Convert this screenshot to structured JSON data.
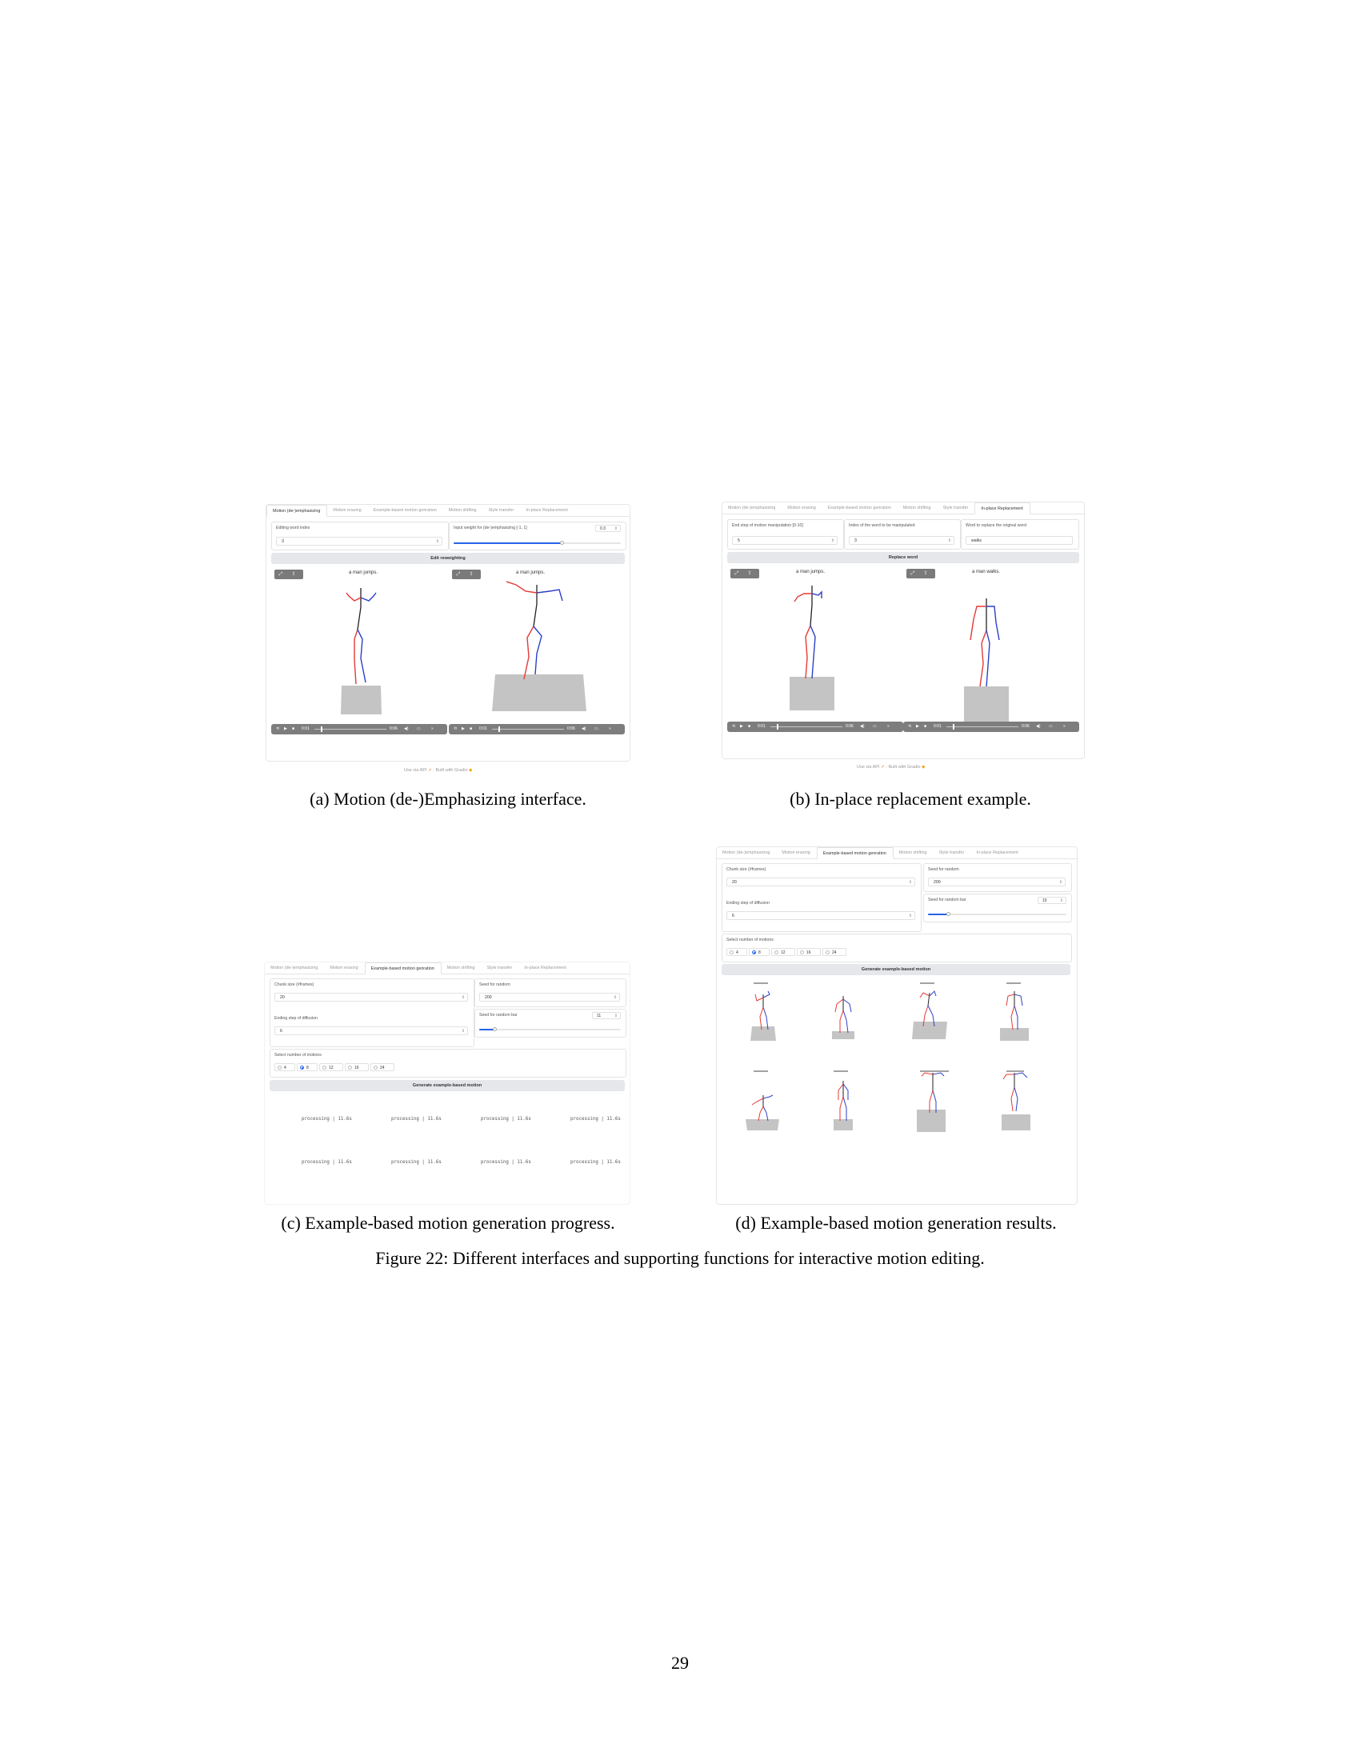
{
  "tabs": [
    "Motion (de-)emphasizing",
    "Motion erasing",
    "Example-based motion genration",
    "Motion shifting",
    "Style transfer",
    "In-place Replacement"
  ],
  "panel_a": {
    "field1_label": "Editing word index",
    "field1_value": "3",
    "field2_label": "Input weight for (de-)emphasizing [-1, 1]",
    "field2_value": "0.3",
    "weight_fraction": 0.65,
    "button": "Edit reweighting",
    "video1_caption": "a man jumps.",
    "video2_caption": "a man jumps.",
    "player1": {
      "current": "0:01",
      "total": "0:06"
    },
    "player2": {
      "current": "0:01",
      "total": "0:06"
    },
    "footer_api": "Use via API",
    "footer_sep": "·",
    "footer_built": "Built with Gradio"
  },
  "panel_b": {
    "field1_label": "End step of motion manipulation [0-10]",
    "field1_value": "5",
    "field2_label": "Index of the word to be manipulated",
    "field2_value": "3",
    "field3_label": "Word to replace the original word",
    "field3_value": "walks",
    "button": "Replace word",
    "video1_caption": "a man jumps.",
    "video2_caption": "a man walks.",
    "player1": {
      "current": "0:01",
      "total": "0:06"
    },
    "player2": {
      "current": "0:01",
      "total": "0:06"
    },
    "footer_api": "Use via API",
    "footer_sep": "·",
    "footer_built": "Built with Gradio"
  },
  "panel_c": {
    "chunk_label": "Chunk size (#frames)",
    "chunk_value": "20",
    "seed_label": "Seed for random",
    "seed_value": "200",
    "ending_label": "Ending step of diffusion",
    "ending_value": "6",
    "seedbar_label": "Seed for random bar",
    "seedbar_value": "11",
    "seedbar_fraction": 0.11,
    "num_label": "Select number of motions",
    "options": [
      "4",
      "8",
      "12",
      "16",
      "24"
    ],
    "selected": "8",
    "button": "Generate example-based motion",
    "progress_text": "processing | 11.6s"
  },
  "panel_d": {
    "chunk_label": "Chunk size (#frames)",
    "chunk_value": "20",
    "seed_label": "Seed for random",
    "seed_value": "200",
    "ending_label": "Ending step of diffusion",
    "ending_value": "6",
    "seedbar_label": "Seed for random bar",
    "seedbar_value": "15",
    "seedbar_fraction": 0.15,
    "num_label": "Select number of motions",
    "options": [
      "4",
      "8",
      "12",
      "16",
      "24"
    ],
    "selected": "8",
    "button": "Generate example-based motion"
  },
  "captions": {
    "a": "(a) Motion (de-)Emphasizing interface.",
    "b": "(b) In-place replacement example.",
    "c": "(c) Example-based motion generation progress.",
    "d": "(d) Example-based motion generation results.",
    "figure": "Figure 22: Different interfaces and supporting functions for interactive motion editing."
  },
  "page_number": "29",
  "colors": {
    "left_limb": "#e53935",
    "right_limb": "#2e3fc8",
    "accent": "#2563eb",
    "floor": "#c4c4c4"
  }
}
